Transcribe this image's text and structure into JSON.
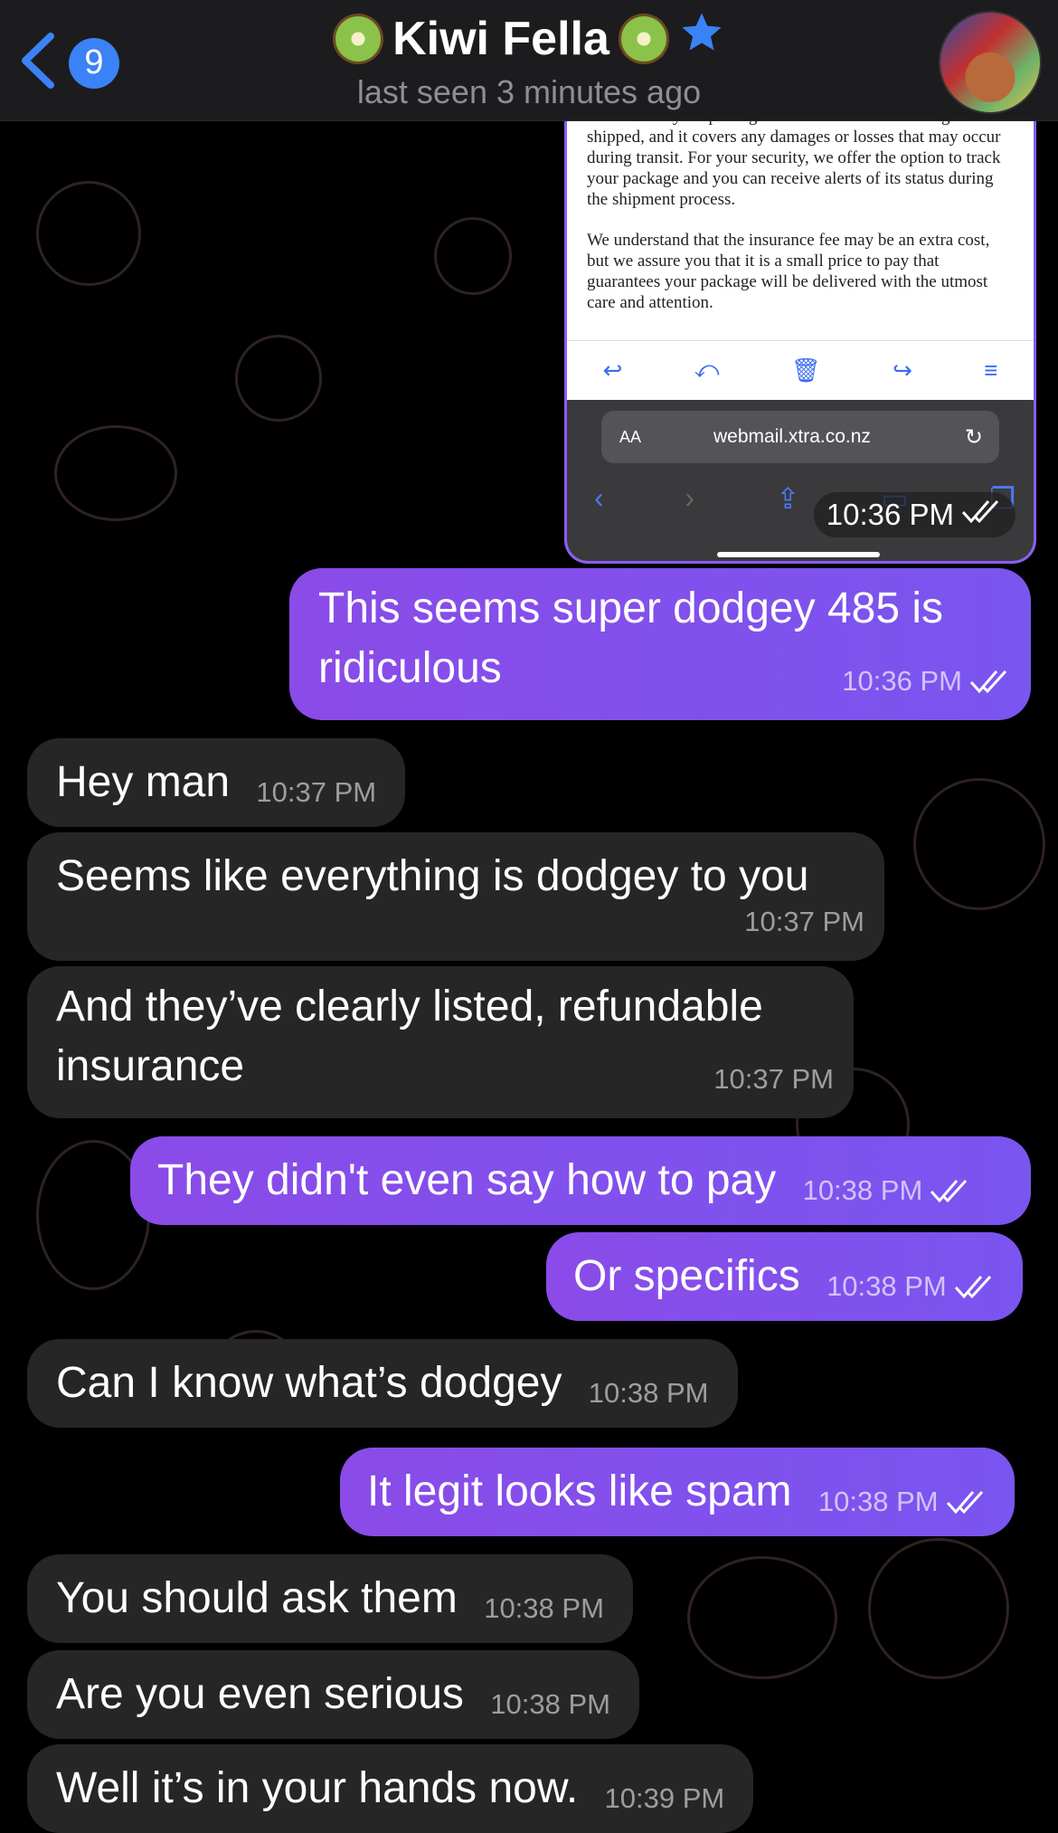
{
  "header": {
    "back_badge": "9",
    "title": "Kiwi Fella",
    "status": "last seen 3 minutes ago"
  },
  "screenshot": {
    "paragraph1": "package, we require a refundable insurance fee. This fee ensures that your package is insured while it is being shipped, and it covers any damages or losses that may occur during transit. For your security, we offer the option to track your package and you can receive alerts of its status during the shipment process.",
    "paragraph2": "We understand that the insurance fee may be an extra cost, but we assure you that it is a small price to pay that guarantees your package will be delivered with the utmost care and attention.",
    "aa_label": "AA",
    "url": "webmail.xtra.co.nz",
    "time": "10:36 PM"
  },
  "messages": [
    {
      "text": "This seems super dodgey 485 is ridiculous",
      "time": "10:36 PM",
      "dir": "out"
    },
    {
      "text": "Hey man",
      "time": "10:37 PM",
      "dir": "in"
    },
    {
      "text": "Seems like everything is dodgey to you",
      "time": "10:37 PM",
      "dir": "in"
    },
    {
      "text": "And they’ve clearly listed, refundable insurance",
      "time": "10:37 PM",
      "dir": "in"
    },
    {
      "text": "They didn't even say how to pay",
      "time": "10:38 PM",
      "dir": "out"
    },
    {
      "text": "Or specifics",
      "time": "10:38 PM",
      "dir": "out"
    },
    {
      "text": "Can I know what’s dodgey",
      "time": "10:38 PM",
      "dir": "in"
    },
    {
      "text": "It legit looks like spam",
      "time": "10:38 PM",
      "dir": "out"
    },
    {
      "text": "You should ask them",
      "time": "10:38 PM",
      "dir": "in"
    },
    {
      "text": "Are you even serious",
      "time": "10:38 PM",
      "dir": "in"
    },
    {
      "text": "Well  it’s in your hands now.",
      "time": "10:39 PM",
      "dir": "in"
    }
  ],
  "colors": {
    "outgoing": "#8a4be8",
    "incoming": "#262626",
    "accent": "#3b82f6"
  }
}
